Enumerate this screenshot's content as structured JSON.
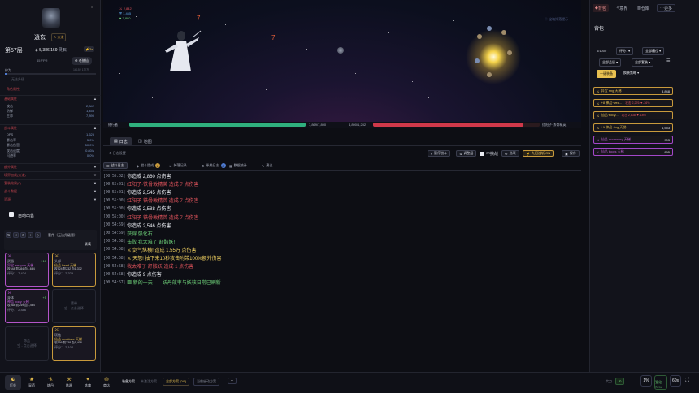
{
  "left": {
    "player_name": "逍玄",
    "player_rank": "大道",
    "floor_label": "第57层",
    "spirit_stones": "5,386,169",
    "spirit_stone_label": "灵石",
    "speed": "2x",
    "level_label": "45 FPR",
    "title_badge": "老修仙",
    "exp_label": "修为",
    "exp_value": "1615 / 1万万",
    "unequipped_label": "无法升级",
    "sections": {
      "basic_title": "角色属性",
      "basic": "基础属性",
      "attack_rows": [
        {
          "k": "攻击",
          "v": "2,842"
        },
        {
          "k": "防御",
          "v": "1,455"
        },
        {
          "k": "生命",
          "v": "7,890"
        }
      ],
      "combat": "战斗属性",
      "combat_rows": [
        {
          "k": "DPS",
          "v": "1,625"
        },
        {
          "k": "暴击率",
          "v": "5.0%"
        },
        {
          "k": "暴击伤害",
          "v": "50.0%"
        },
        {
          "k": "攻击速度",
          "v": "0.80/s"
        },
        {
          "k": "闪避率",
          "v": "0.0%"
        }
      ],
      "s3": "额外属性",
      "s4": "境界加成(大道)",
      "s5": "套装效果(0)",
      "s6": "战斗数据",
      "s7": "资源"
    },
    "auto_sell": "自动出售",
    "equip_header_label": "套件（无法升级套）",
    "equip_header_btn": "紧凑",
    "equipment": [
      {
        "slot": "武器",
        "name": "异宝 weapon 天梯",
        "stats": "攻648 防284 血1,664",
        "score": "评分： 7,424",
        "plus": "+10"
      },
      {
        "slot": "头部",
        "name": "仙品 head 天梯",
        "stats": "攻524 防232 血1,372",
        "score": "评分： 2,329",
        "plus": ""
      },
      {
        "slot": "身体",
        "name": "神品 body 天梯",
        "stats": "攻568 防249 血1,464",
        "score": "评分： 2,486",
        "plus": "+5"
      },
      {
        "slot": "项链",
        "name": "仙品 necklace 天梯",
        "stats": "攻556 防238 血1,408",
        "score": "评分： 2,102",
        "plus": ""
      }
    ],
    "empty_slots": [
      {
        "slot": "腰带",
        "label": "空 - 点击选择"
      },
      {
        "slot": "饰品",
        "label": "空 - 点击选择"
      }
    ]
  },
  "scene": {
    "stats": [
      "2,842",
      "1,455",
      "7,890"
    ],
    "damage_numbers": [
      "7",
      "7"
    ],
    "top_right_note": "◇ 宝箱掉落提示",
    "player_hp": "7,869/7,890",
    "enemy_hp": "4,890/1,282",
    "player_bar_label": "修行者",
    "enemy_label": "红阳子·炼骨精英",
    "player_hp_fraction": 0.997,
    "enemy_hp_fraction": 0.9
  },
  "tabs": {
    "log": "日志",
    "map": "地图",
    "filter_label": "日志设置"
  },
  "toolbar": {
    "b1": "暂停战斗",
    "b2": "调整层",
    "b3": "不挑战",
    "b4": "选项",
    "b5": "九阳连斩 ON",
    "b6": "保存"
  },
  "subtabs": [
    {
      "label": "战斗日志",
      "badge": ""
    },
    {
      "label": "战斗提成",
      "badge": "8"
    },
    {
      "label": "掉落记录",
      "badge": ""
    },
    {
      "label": "系统日志",
      "badge": "8"
    },
    {
      "label": "数据统计",
      "badge": ""
    },
    {
      "label": "建议",
      "badge": ""
    }
  ],
  "log_lines": [
    {
      "ts": "[00:55:02]",
      "text": "你造成 2,860 点伤害",
      "color": "#e9ebf1"
    },
    {
      "ts": "[00:55:01]",
      "text": "红阳子·铁骨敦精英 造成 7 点伤害",
      "color": "#e0545c"
    },
    {
      "ts": "[00:55:01]",
      "text": "你造成 2,545 点伤害",
      "color": "#e9ebf1"
    },
    {
      "ts": "[00:55:00]",
      "text": "红阳子·铁骨敦精英 造成 7 点伤害",
      "color": "#e0545c"
    },
    {
      "ts": "[00:55:00]",
      "text": "你造成 2,588 点伤害",
      "color": "#e9ebf1"
    },
    {
      "ts": "[00:55:00]",
      "text": "红阳子·铁骨敦精英 造成 7 点伤害",
      "color": "#e0545c"
    },
    {
      "ts": "[00:54:59]",
      "text": "你造成 2,546 点伤害",
      "color": "#e9ebf1"
    },
    {
      "ts": "[00:54:59]",
      "text": "获得 强化石",
      "color": "#6fd27a"
    },
    {
      "ts": "[00:54:58]",
      "text": "击败 我太难了 舒骸妖!",
      "color": "#6fd27a"
    },
    {
      "ts": "[00:54:58]",
      "text": "⚔ 剑气纵横! 造成 1.55万 点伤害",
      "color": "#f0d060"
    },
    {
      "ts": "[00:54:58]",
      "text": "⚔ 天怒! 抽下来10秒攻击附带100%额外伤害",
      "color": "#f0d060"
    },
    {
      "ts": "[00:54:58]",
      "text": "我太难了 舒骸妖 造成 1 点伤害",
      "color": "#e0545c"
    },
    {
      "ts": "[00:54:58]",
      "text": "你造成 9 点伤害",
      "color": "#e9ebf1"
    },
    {
      "ts": "[00:54:57]",
      "text": "▩ 新的一天——妖丹效率与妖核日常已刷新",
      "color": "#6fd27a"
    }
  ],
  "right": {
    "tabs": [
      "背包",
      "境界",
      "仓库",
      "更多"
    ],
    "title": "背包",
    "capacity": "6/1000",
    "sort_label": "评分↓",
    "filter_all": "全部槽位",
    "filter_quality": "全部品质",
    "filter_set": "全部套装",
    "btn_one_click": "一键装备",
    "btn_replace": "换装策略",
    "items": [
      {
        "name": "异宝 ring 天梯",
        "extra": "",
        "val": "3,848",
        "purple": false
      },
      {
        "name": "+8 神品·wea...",
        "extra": "攻击 2,276 ▼-36%",
        "val": "",
        "purple": false
      },
      {
        "name": "仙品·body...",
        "extra": "攻击 2,838 ▼-18%",
        "val": "",
        "purple": false
      },
      {
        "name": "+1 神品·ring 天梯",
        "extra": "",
        "val": "1,553",
        "purple": false
      },
      {
        "name": "仙品 accessory 天梯",
        "extra": "",
        "val": "903",
        "purple": true
      },
      {
        "name": "仙品 boots 天梯",
        "extra": "",
        "val": "895",
        "purple": true
      }
    ]
  },
  "bottom": {
    "nav": [
      "打坐",
      "采药",
      "炼丹",
      "炼器",
      "炼魂",
      "商店"
    ],
    "plan_label": "装备方案",
    "plan_hint": "未激活方案",
    "plan1": "全部方案 (0/0)",
    "plan2": "当前启动方案",
    "plan_add": "+",
    "tag1": "实力",
    "tag1_val": "1%",
    "tag2": "强化 70%",
    "tag3": "自动",
    "tag4": "60s"
  }
}
